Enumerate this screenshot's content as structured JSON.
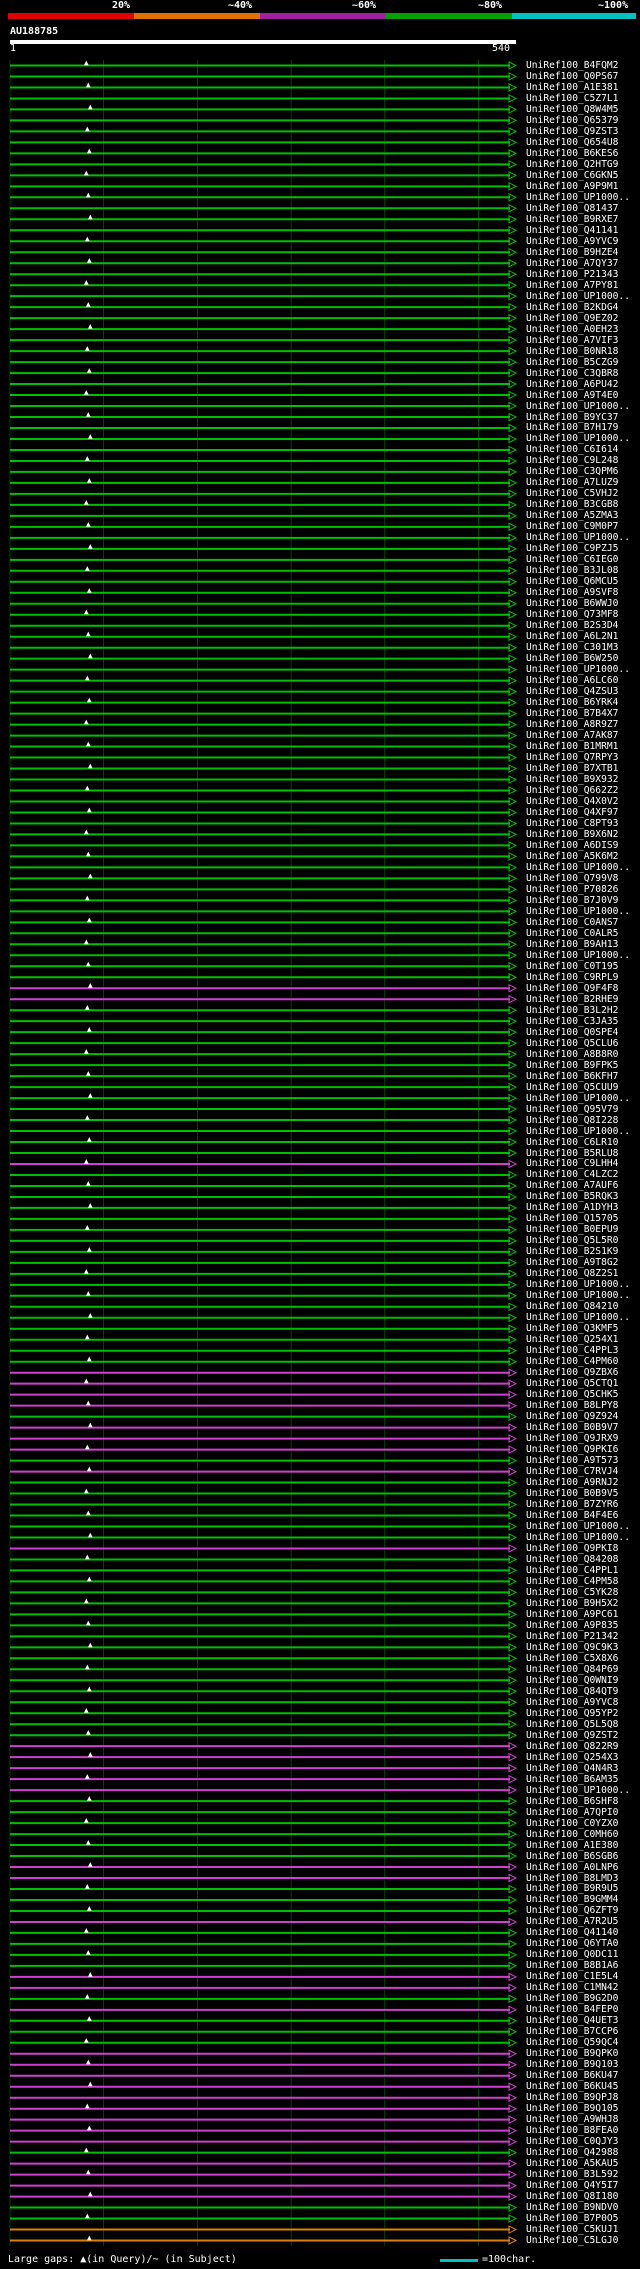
{
  "legend": {
    "bands": [
      {
        "label": "20%",
        "color": "#e00000"
      },
      {
        "label": "~40%",
        "color": "#e07000"
      },
      {
        "label": "~60%",
        "color": "#a020a0"
      },
      {
        "label": "~80%",
        "color": "#00a000"
      },
      {
        "label": "~100%",
        "color": "#00c0c0"
      }
    ]
  },
  "query": {
    "title": "AU188785",
    "start": "1",
    "end": "540"
  },
  "colors": {
    "green": "#00c000",
    "magenta": "#d040d0",
    "orange": "#e08000",
    "gap": "#606060",
    "grid": "#00a000"
  },
  "footer": {
    "gaps_text": "Large gaps: ▲(in Query)/~ (in Subject)",
    "scale_text": "=100char."
  },
  "hits": [
    {
      "label": "UniRef100_B4FQM2",
      "c": "g"
    },
    {
      "label": "UniRef100_Q0PS67",
      "c": "g"
    },
    {
      "label": "UniRef100_A1E381",
      "c": "g"
    },
    {
      "label": "UniRef100_C5Z7L1",
      "c": "g"
    },
    {
      "label": "UniRef100_Q8W4M5",
      "c": "g"
    },
    {
      "label": "UniRef100_Q65379",
      "c": "g"
    },
    {
      "label": "UniRef100_Q9ZST3",
      "c": "g"
    },
    {
      "label": "UniRef100_Q654U8",
      "c": "g"
    },
    {
      "label": "UniRef100_B6KES6",
      "c": "g"
    },
    {
      "label": "UniRef100_Q2HTG9",
      "c": "g"
    },
    {
      "label": "UniRef100_C6GKN5",
      "c": "g"
    },
    {
      "label": "UniRef100_A9P9M1",
      "c": "g"
    },
    {
      "label": "UniRef100_UP1000..",
      "c": "g"
    },
    {
      "label": "UniRef100_Q81437",
      "c": "g"
    },
    {
      "label": "UniRef100_B9RXE7",
      "c": "g"
    },
    {
      "label": "UniRef100_Q41141",
      "c": "g"
    },
    {
      "label": "UniRef100_A9YVC9",
      "c": "g"
    },
    {
      "label": "UniRef100_B9HZE4",
      "c": "g"
    },
    {
      "label": "UniRef100_A7QY37",
      "c": "g"
    },
    {
      "label": "UniRef100_P21343",
      "c": "g"
    },
    {
      "label": "UniRef100_A7PY81",
      "c": "g"
    },
    {
      "label": "UniRef100_UP1000..",
      "c": "g"
    },
    {
      "label": "UniRef100_B2KDG4",
      "c": "g"
    },
    {
      "label": "UniRef100_Q9EZ02",
      "c": "g"
    },
    {
      "label": "UniRef100_A0EH23",
      "c": "g"
    },
    {
      "label": "UniRef100_A7VIF3",
      "c": "g"
    },
    {
      "label": "UniRef100_B0NR18",
      "c": "g"
    },
    {
      "label": "UniRef100_B5CZG9",
      "c": "g"
    },
    {
      "label": "UniRef100_C3QBR8",
      "c": "g"
    },
    {
      "label": "UniRef100_A6PU42",
      "c": "g"
    },
    {
      "label": "UniRef100_A9T4E0",
      "c": "g"
    },
    {
      "label": "UniRef100_UP1000..",
      "c": "g"
    },
    {
      "label": "UniRef100_B9YC37",
      "c": "g"
    },
    {
      "label": "UniRef100_B7H179",
      "c": "g"
    },
    {
      "label": "UniRef100_UP1000..",
      "c": "g"
    },
    {
      "label": "UniRef100_C6I614",
      "c": "g"
    },
    {
      "label": "UniRef100_C9L248",
      "c": "g"
    },
    {
      "label": "UniRef100_C3QPM6",
      "c": "g"
    },
    {
      "label": "UniRef100_A7LUZ9",
      "c": "g"
    },
    {
      "label": "UniRef100_C5VHJ2",
      "c": "g"
    },
    {
      "label": "UniRef100_B3CGB8",
      "c": "g"
    },
    {
      "label": "UniRef100_A5ZMA3",
      "c": "g"
    },
    {
      "label": "UniRef100_C9M0P7",
      "c": "g"
    },
    {
      "label": "UniRef100_UP1000..",
      "c": "g"
    },
    {
      "label": "UniRef100_C9PZJ5",
      "c": "g"
    },
    {
      "label": "UniRef100_C6IEG0",
      "c": "g"
    },
    {
      "label": "UniRef100_B3JL08",
      "c": "g"
    },
    {
      "label": "UniRef100_Q6MCU5",
      "c": "g"
    },
    {
      "label": "UniRef100_A9SVF8",
      "c": "g"
    },
    {
      "label": "UniRef100_B6WWJ0",
      "c": "g"
    },
    {
      "label": "UniRef100_Q73MF8",
      "c": "g"
    },
    {
      "label": "UniRef100_B2S3D4",
      "c": "g"
    },
    {
      "label": "UniRef100_A6L2N1",
      "c": "g"
    },
    {
      "label": "UniRef100_C301M3",
      "c": "g"
    },
    {
      "label": "UniRef100_B6W250",
      "c": "g"
    },
    {
      "label": "UniRef100_UP1000..",
      "c": "g"
    },
    {
      "label": "UniRef100_A6LC60",
      "c": "g"
    },
    {
      "label": "UniRef100_Q4ZSU3",
      "c": "g"
    },
    {
      "label": "UniRef100_B6YRK4",
      "c": "g"
    },
    {
      "label": "UniRef100_B7B4X7",
      "c": "g"
    },
    {
      "label": "UniRef100_A8R9Z7",
      "c": "g"
    },
    {
      "label": "UniRef100_A7AK87",
      "c": "g"
    },
    {
      "label": "UniRef100_B1MRM1",
      "c": "g"
    },
    {
      "label": "UniRef100_Q7RPY3",
      "c": "g"
    },
    {
      "label": "UniRef100_B7XTB1",
      "c": "g"
    },
    {
      "label": "UniRef100_B9X932",
      "c": "g"
    },
    {
      "label": "UniRef100_Q662Z2",
      "c": "g"
    },
    {
      "label": "UniRef100_Q4X0V2",
      "c": "g"
    },
    {
      "label": "UniRef100_Q4XF97",
      "c": "g"
    },
    {
      "label": "UniRef100_C8PT93",
      "c": "g"
    },
    {
      "label": "UniRef100_B9X6N2",
      "c": "g"
    },
    {
      "label": "UniRef100_A6DIS9",
      "c": "g"
    },
    {
      "label": "UniRef100_A5K6M2",
      "c": "g"
    },
    {
      "label": "UniRef100_UP1000..",
      "c": "g"
    },
    {
      "label": "UniRef100_Q799V8",
      "c": "g"
    },
    {
      "label": "UniRef100_P70826",
      "c": "g"
    },
    {
      "label": "UniRef100_B7J0V9",
      "c": "g"
    },
    {
      "label": "UniRef100_UP1000..",
      "c": "g"
    },
    {
      "label": "UniRef100_C0ANS7",
      "c": "g"
    },
    {
      "label": "UniRef100_C0ALR5",
      "c": "g"
    },
    {
      "label": "UniRef100_B9AH13",
      "c": "g"
    },
    {
      "label": "UniRef100_UP1000..",
      "c": "g"
    },
    {
      "label": "UniRef100_C0T195",
      "c": "g"
    },
    {
      "label": "UniRef100_C9RPL9",
      "c": "g"
    },
    {
      "label": "UniRef100_Q9F4F8",
      "c": "m"
    },
    {
      "label": "UniRef100_B2RHE9",
      "c": "m"
    },
    {
      "label": "UniRef100_B3L2H2",
      "c": "g"
    },
    {
      "label": "UniRef100_C3JA35",
      "c": "g"
    },
    {
      "label": "UniRef100_Q0SPE4",
      "c": "g"
    },
    {
      "label": "UniRef100_Q5CLU6",
      "c": "g"
    },
    {
      "label": "UniRef100_A8B8R0",
      "c": "g"
    },
    {
      "label": "UniRef100_B9FPK5",
      "c": "g"
    },
    {
      "label": "UniRef100_B6KFH7",
      "c": "g"
    },
    {
      "label": "UniRef100_Q5CUU9",
      "c": "g"
    },
    {
      "label": "UniRef100_UP1000..",
      "c": "g"
    },
    {
      "label": "UniRef100_Q95V79",
      "c": "g"
    },
    {
      "label": "UniRef100_Q8I228",
      "c": "g"
    },
    {
      "label": "UniRef100_UP1000..",
      "c": "g"
    },
    {
      "label": "UniRef100_C6LR10",
      "c": "g"
    },
    {
      "label": "UniRef100_B5RLU8",
      "c": "g"
    },
    {
      "label": "UniRef100_C9LHH4",
      "c": "m"
    },
    {
      "label": "UniRef100_C4LZC2",
      "c": "g"
    },
    {
      "label": "UniRef100_A7AUF6",
      "c": "g"
    },
    {
      "label": "UniRef100_B5RQK3",
      "c": "g"
    },
    {
      "label": "UniRef100_A1DYH3",
      "c": "g"
    },
    {
      "label": "UniRef100_Q15705",
      "c": "g"
    },
    {
      "label": "UniRef100_B0EPU9",
      "c": "g"
    },
    {
      "label": "UniRef100_Q5L5R0",
      "c": "g"
    },
    {
      "label": "UniRef100_B2S1K9",
      "c": "g"
    },
    {
      "label": "UniRef100_A9T8G2",
      "c": "g"
    },
    {
      "label": "UniRef100_Q8Z2S1",
      "c": "g"
    },
    {
      "label": "UniRef100_UP1000..",
      "c": "g"
    },
    {
      "label": "UniRef100_UP1000..",
      "c": "g"
    },
    {
      "label": "UniRef100_Q84210",
      "c": "g"
    },
    {
      "label": "UniRef100_UP1000..",
      "c": "g"
    },
    {
      "label": "UniRef100_Q3KMF5",
      "c": "g"
    },
    {
      "label": "UniRef100_Q254X1",
      "c": "g"
    },
    {
      "label": "UniRef100_C4PPL3",
      "c": "g"
    },
    {
      "label": "UniRef100_C4PM60",
      "c": "g"
    },
    {
      "label": "UniRef100_Q9ZBX6",
      "c": "m"
    },
    {
      "label": "UniRef100_Q5CTQ1",
      "c": "m"
    },
    {
      "label": "UniRef100_Q5CHK5",
      "c": "m"
    },
    {
      "label": "UniRef100_B8LPY8",
      "c": "m"
    },
    {
      "label": "UniRef100_Q9Z924",
      "c": "g"
    },
    {
      "label": "UniRef100_B0B9V7",
      "c": "m"
    },
    {
      "label": "UniRef100_Q9JRX9",
      "c": "m"
    },
    {
      "label": "UniRef100_Q9PKI6",
      "c": "m"
    },
    {
      "label": "UniRef100_A9T573",
      "c": "g"
    },
    {
      "label": "UniRef100_C7RVJ4",
      "c": "m"
    },
    {
      "label": "UniRef100_A9RNJ2",
      "c": "g"
    },
    {
      "label": "UniRef100_B0B9V5",
      "c": "g"
    },
    {
      "label": "UniRef100_B7ZYR6",
      "c": "g"
    },
    {
      "label": "UniRef100_B4F4E6",
      "c": "g"
    },
    {
      "label": "UniRef100_UP1000..",
      "c": "g"
    },
    {
      "label": "UniRef100_UP1000..",
      "c": "g"
    },
    {
      "label": "UniRef100_Q9PKI8",
      "c": "m"
    },
    {
      "label": "UniRef100_Q84208",
      "c": "g"
    },
    {
      "label": "UniRef100_C4PPL1",
      "c": "g"
    },
    {
      "label": "UniRef100_C4PM58",
      "c": "g"
    },
    {
      "label": "UniRef100_C5YK28",
      "c": "g"
    },
    {
      "label": "UniRef100_B9H5X2",
      "c": "g"
    },
    {
      "label": "UniRef100_A9PC61",
      "c": "g"
    },
    {
      "label": "UniRef100_A9P835",
      "c": "g"
    },
    {
      "label": "UniRef100_P21342",
      "c": "g"
    },
    {
      "label": "UniRef100_Q9C9K3",
      "c": "g"
    },
    {
      "label": "UniRef100_C5X8X6",
      "c": "g"
    },
    {
      "label": "UniRef100_Q84P69",
      "c": "g"
    },
    {
      "label": "UniRef100_Q0WNI9",
      "c": "g"
    },
    {
      "label": "UniRef100_Q84QT9",
      "c": "g"
    },
    {
      "label": "UniRef100_A9YVC8",
      "c": "g"
    },
    {
      "label": "UniRef100_Q95YP2",
      "c": "g"
    },
    {
      "label": "UniRef100_Q5L5Q8",
      "c": "g"
    },
    {
      "label": "UniRef100_Q9ZST2",
      "c": "g"
    },
    {
      "label": "UniRef100_Q822R9",
      "c": "m"
    },
    {
      "label": "UniRef100_Q254X3",
      "c": "m"
    },
    {
      "label": "UniRef100_Q4N4R3",
      "c": "m"
    },
    {
      "label": "UniRef100_B6AM35",
      "c": "m"
    },
    {
      "label": "UniRef100_UP1000..",
      "c": "m"
    },
    {
      "label": "UniRef100_B6SHF8",
      "c": "g"
    },
    {
      "label": "UniRef100_A7QPI0",
      "c": "g"
    },
    {
      "label": "UniRef100_C0YZX0",
      "c": "g"
    },
    {
      "label": "UniRef100_C0MH60",
      "c": "g"
    },
    {
      "label": "UniRef100_A1E380",
      "c": "g"
    },
    {
      "label": "UniRef100_B6SGB6",
      "c": "g"
    },
    {
      "label": "UniRef100_A0LNP6",
      "c": "m"
    },
    {
      "label": "UniRef100_B8LMD3",
      "c": "m"
    },
    {
      "label": "UniRef100_B9R9U5",
      "c": "g"
    },
    {
      "label": "UniRef100_B9GMM4",
      "c": "g"
    },
    {
      "label": "UniRef100_Q6ZFT9",
      "c": "g"
    },
    {
      "label": "UniRef100_A7R2U5",
      "c": "m"
    },
    {
      "label": "UniRef100_Q41140",
      "c": "g"
    },
    {
      "label": "UniRef100_Q6YTA0",
      "c": "g"
    },
    {
      "label": "UniRef100_Q0DC11",
      "c": "g"
    },
    {
      "label": "UniRef100_B8B1A6",
      "c": "g"
    },
    {
      "label": "UniRef100_C1E5L4",
      "c": "m"
    },
    {
      "label": "UniRef100_C1MN42",
      "c": "m"
    },
    {
      "label": "UniRef100_B9G2D0",
      "c": "g"
    },
    {
      "label": "UniRef100_B4FEP0",
      "c": "m"
    },
    {
      "label": "UniRef100_Q4UET3",
      "c": "g"
    },
    {
      "label": "UniRef100_B7CCP6",
      "c": "g"
    },
    {
      "label": "UniRef100_Q59QC4",
      "c": "g"
    },
    {
      "label": "UniRef100_B9QPK0",
      "c": "m"
    },
    {
      "label": "UniRef100_B9Q103",
      "c": "m"
    },
    {
      "label": "UniRef100_B6KU47",
      "c": "m"
    },
    {
      "label": "UniRef100_B6KU45",
      "c": "m"
    },
    {
      "label": "UniRef100_B9QPJ8",
      "c": "m"
    },
    {
      "label": "UniRef100_B9Q105",
      "c": "m"
    },
    {
      "label": "UniRef100_A9WHJ8",
      "c": "m"
    },
    {
      "label": "UniRef100_B8FEA0",
      "c": "m"
    },
    {
      "label": "UniRef100_C0QJY3",
      "c": "m"
    },
    {
      "label": "UniRef100_Q42988",
      "c": "g"
    },
    {
      "label": "UniRef100_A5KAU5",
      "c": "m"
    },
    {
      "label": "UniRef100_B3L592",
      "c": "m"
    },
    {
      "label": "UniRef100_Q4Y5I7",
      "c": "m"
    },
    {
      "label": "UniRef100_Q8I180",
      "c": "m"
    },
    {
      "label": "UniRef100_B9NDV0",
      "c": "g"
    },
    {
      "label": "UniRef100_B7P0O5",
      "c": "g"
    },
    {
      "label": "UniRef100_C5KUJ1",
      "c": "o"
    },
    {
      "label": "UniRef100_C5LGJ0",
      "c": "o"
    }
  ]
}
